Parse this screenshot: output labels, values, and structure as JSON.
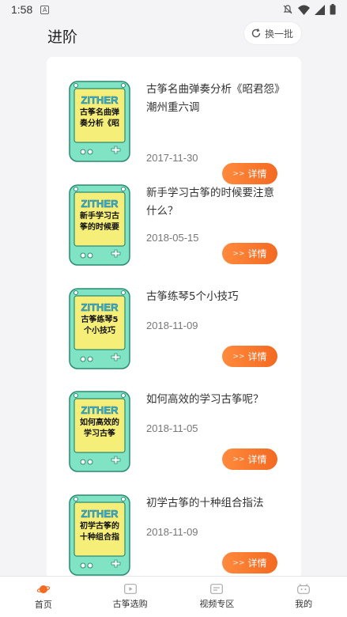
{
  "status": {
    "time": "1:58",
    "badge": "A"
  },
  "header": {
    "title": "进阶",
    "swap_label": "换一批"
  },
  "thumb_brand": "ZITHER",
  "items": [
    {
      "title": "古筝名曲弹奏分析《昭君怨》潮州重六调",
      "date": "2017-11-30",
      "thumb_text": "古筝名曲弹奏分析《昭",
      "button": "详情"
    },
    {
      "title": "新手学习古筝的时候要注意什么？",
      "date": "2018-05-15",
      "thumb_text": "新手学习古筝的时候要",
      "button": "详情"
    },
    {
      "title": "古筝练琴5个小技巧",
      "date": "2018-11-09",
      "thumb_text": "古筝练琴5个小技巧",
      "button": "详情"
    },
    {
      "title": "如何高效的学习古筝呢？",
      "date": "2018-11-05",
      "thumb_text": "如何高效的学习古筝",
      "button": "详情"
    },
    {
      "title": "初学古筝的十种组合指法",
      "date": "2018-11-09",
      "thumb_text": "初学古筝的十种组合指",
      "button": "详情"
    }
  ],
  "detail_arrow": ">>",
  "tabs": [
    {
      "label": "首页",
      "icon": "planet-icon",
      "active": true
    },
    {
      "label": "古筝选购",
      "icon": "play-icon",
      "active": false
    },
    {
      "label": "视频专区",
      "icon": "message-icon",
      "active": false
    },
    {
      "label": "我的",
      "icon": "face-icon",
      "active": false
    }
  ],
  "colors": {
    "accent": "#f36a22",
    "thumb_bg": "#7fe3c4",
    "thumb_inner": "#f5ef7a",
    "brand_text": "#36b7d8"
  }
}
